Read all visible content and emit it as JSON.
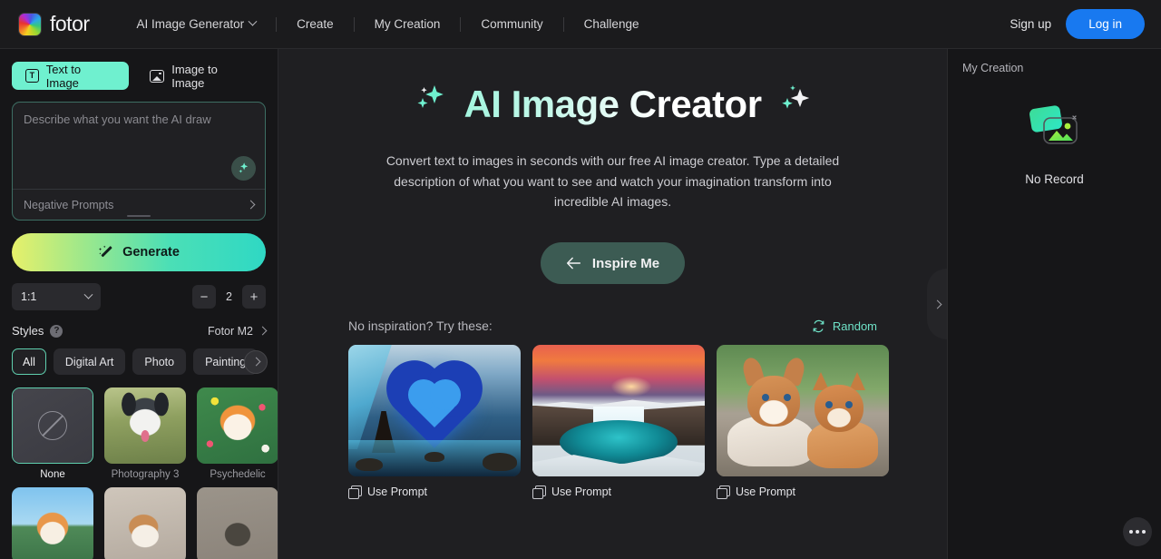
{
  "nav": {
    "brand": "fotor",
    "brand_icon": "fotor-logo-icon",
    "items": [
      {
        "label": "AI Image Generator",
        "has_dropdown": true
      },
      {
        "label": "Create",
        "has_dropdown": false
      },
      {
        "label": "My Creation",
        "has_dropdown": false
      },
      {
        "label": "Community",
        "has_dropdown": false
      },
      {
        "label": "Challenge",
        "has_dropdown": false
      }
    ],
    "signup_label": "Sign up",
    "login_label": "Log in",
    "login_color": "#1879f0"
  },
  "sidebar": {
    "modes": [
      {
        "label": "Text to Image",
        "icon": "text-icon",
        "active": true
      },
      {
        "label": "Image to Image",
        "icon": "image-icon",
        "active": false
      }
    ],
    "prompt": {
      "value": "",
      "placeholder": "Describe what you want the AI draw",
      "enhance_icon": "sparkle-icon",
      "negative_label": "Negative Prompts",
      "expand_icon": "chevron-right-icon"
    },
    "generate_label": "Generate",
    "generate_icon": "magic-wand-icon",
    "generate_gradient": [
      "#e7f06a",
      "#4bdfb6",
      "#2fd8c4"
    ],
    "aspect_ratio": {
      "value": "1:1",
      "icon": "chevron-down-icon"
    },
    "count": {
      "value": "2",
      "minus": "−",
      "plus": "+"
    },
    "styles": {
      "title": "Styles",
      "help_icon": "question-icon",
      "model_label": "Fotor M2",
      "model_icon": "chevron-right-icon",
      "categories": [
        {
          "label": "All",
          "active": true
        },
        {
          "label": "Digital Art",
          "active": false
        },
        {
          "label": "Photo",
          "active": false
        },
        {
          "label": "Painting",
          "active": false
        }
      ],
      "next_icon": "chevron-right-icon",
      "items": [
        {
          "label": "None",
          "selected": true,
          "art": "none"
        },
        {
          "label": "Photography 3",
          "selected": false,
          "art": "dog1"
        },
        {
          "label": "Psychedelic",
          "selected": false,
          "art": "psych"
        },
        {
          "label": "",
          "selected": false,
          "art": "shiba"
        },
        {
          "label": "",
          "selected": false,
          "art": "dog2"
        },
        {
          "label": "",
          "selected": false,
          "art": "tattoo"
        }
      ]
    }
  },
  "main": {
    "title": "AI Image Creator",
    "title_sparkle_left": "sparkles-icon",
    "title_sparkle_right": "sparkles-icon",
    "description": "Convert text to images in seconds with our free AI image creator. Type a detailed description of what you want to see and watch your imagination transform into incredible AI images.",
    "inspire_label": "Inspire Me",
    "inspire_icon": "arrow-left-icon",
    "inspire_color": "#3c5b53",
    "try_label": "No inspiration? Try these:",
    "random_label": "Random",
    "random_icon": "refresh-icon",
    "random_color": "#6fe3c8",
    "samples": [
      {
        "use_label": "Use Prompt",
        "icon": "copy-icon",
        "art": "heart"
      },
      {
        "use_label": "Use Prompt",
        "icon": "copy-icon",
        "art": "falls"
      },
      {
        "use_label": "Use Prompt",
        "icon": "copy-icon",
        "art": "pets"
      }
    ],
    "collapse_icon": "chevron-right-icon"
  },
  "right": {
    "title": "My Creation",
    "empty_label": "No Record",
    "empty_icon": "no-record-image-icon",
    "more_icon": "more-dots-icon"
  }
}
